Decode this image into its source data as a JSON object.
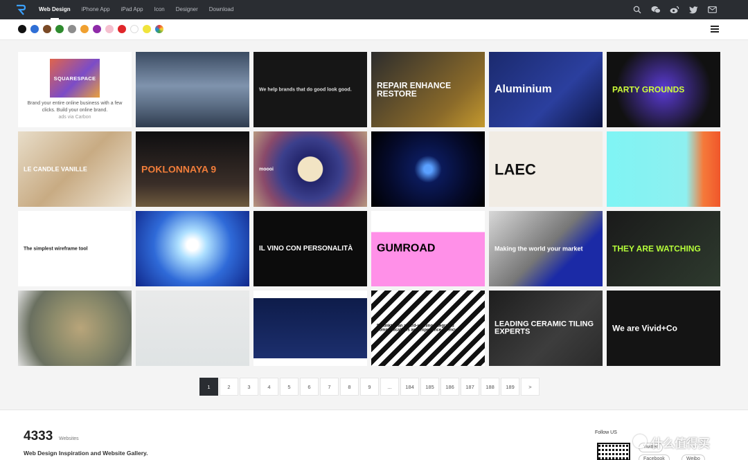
{
  "colors": {
    "topbar": "#2a2d32",
    "accent": "#1e90ff"
  },
  "nav": {
    "items": [
      {
        "label": "Web Design",
        "active": true
      },
      {
        "label": "iPhone App",
        "active": false
      },
      {
        "label": "iPad App",
        "active": false
      },
      {
        "label": "Icon",
        "active": false
      },
      {
        "label": "Designer",
        "active": false
      },
      {
        "label": "Download",
        "active": false
      }
    ],
    "icons": [
      "search-icon",
      "wechat-icon",
      "weibo-icon",
      "twitter-icon",
      "mail-icon"
    ]
  },
  "color_filter": {
    "swatches": [
      "#111111",
      "#2f6fd6",
      "#7a4a26",
      "#2e8b2e",
      "#8d8d8d",
      "#f0a030",
      "#8e2aa8",
      "#f5c0cf",
      "#e0262a",
      "#ffffff",
      "#f0e43c",
      "multicolor"
    ]
  },
  "gallery": {
    "ad": {
      "logo_text": "SQUARESPACE",
      "text": "Brand your entire online business with a few clicks. Build your online brand.",
      "via": "ads via Carbon"
    },
    "cards": [
      {
        "name": "polestar",
        "text": "",
        "bg": "linear-gradient(180deg,#3b4b62 0%,#7f93ad 45%,#5d6f86 70%,#2f3c4f 100%)",
        "fg": "#ffffff",
        "size": 8
      },
      {
        "name": "we-help-brands",
        "text": "We help brands that do good look good.",
        "bg": "#161616",
        "fg": "#dddddd",
        "size": 7
      },
      {
        "name": "repair-enhance-restore",
        "text": "REPAIR ENHANCE RESTORE",
        "bg": "linear-gradient(135deg,#2d2d2d,#8a6a2a 70%,#c59a2e)",
        "fg": "#ffffff",
        "size": 12
      },
      {
        "name": "aluminium",
        "text": "Aluminium",
        "bg": "linear-gradient(135deg,#1b2a6e,#2b3f9e 60%,#0c1440)",
        "fg": "#ffffff",
        "size": 16
      },
      {
        "name": "party-grounds",
        "text": "PARTY GROUNDS",
        "bg": "radial-gradient(circle at 50% 50%,#5b3bd6,#111 70%)",
        "fg": "#cfff3a",
        "size": 12
      },
      {
        "name": "le-candle-vanille",
        "text": "LE CANDLE VANILLE",
        "bg": "linear-gradient(135deg,#e8ddc9,#c8ab83 50%,#efe6d6)",
        "fg": "#ffffff",
        "size": 9
      },
      {
        "name": "poklonnaya",
        "text": "POKLONNAYA 9",
        "bg": "linear-gradient(180deg,#0e0e10,#3a2e28 70%,#6e5a3e)",
        "fg": "#f07d3a",
        "size": 14
      },
      {
        "name": "moooi",
        "text": "moooi",
        "bg": "radial-gradient(circle,#f2e4c4 18%,#23256b 19%,#3b3f8c 45%,#8a4a6a 70%,#b89a80)",
        "fg": "#ffffff",
        "size": 7
      },
      {
        "name": "particle-space",
        "text": "",
        "bg": "radial-gradient(circle,#5aa0ff 6%,#0b1a5a 20%,#050a2a 60%,#000)",
        "fg": "#ffffff",
        "size": 7
      },
      {
        "name": "laec",
        "text": "LAEC",
        "bg": "#f1ece4",
        "fg": "#111111",
        "size": 22
      },
      {
        "name": "cyan-orange",
        "text": "",
        "bg": "linear-gradient(90deg,#7ff4f4 0%,#8ef0f0 70%,#f57a3a 85%,#f0562a)",
        "fg": "#333333",
        "size": 7
      },
      {
        "name": "simplest-wireframe",
        "text": "The simplest wireframe tool",
        "bg": "#ffffff",
        "fg": "#222222",
        "size": 7
      },
      {
        "name": "solar-flare",
        "text": "",
        "bg": "radial-gradient(circle at 50% 45%,#ffffff 8%,#aee0ff 20%,#2f6ad8 55%,#10278a)",
        "fg": "#ffffff",
        "size": 7
      },
      {
        "name": "il-vino",
        "text": "IL VINO CON PERSONALITÀ",
        "bg": "#0c0c0c",
        "fg": "#ffffff",
        "size": 10
      },
      {
        "name": "gumroad",
        "text": "GUMROAD",
        "bg": "linear-gradient(180deg,#ffffff 0,#ffffff 28%,#ff90e8 28%,#ff90e8 100%)",
        "fg": "#000000",
        "size": 16
      },
      {
        "name": "making-world",
        "text": "Making the world your market",
        "bg": "linear-gradient(135deg,#d8d8d8,#777 50%,#1b2aa6 70%,#1b2aa6)",
        "fg": "#ffffff",
        "size": 9
      },
      {
        "name": "they-are-watching",
        "text": "THEY ARE WATCHING",
        "bg": "linear-gradient(135deg,#1a1a1a,#2e3a2e)",
        "fg": "#b6ff3a",
        "size": 12
      },
      {
        "name": "aerial-map",
        "text": "",
        "bg": "radial-gradient(circle at 55% 50%,#b9a57a,#8b8a6a 40%,#6a7060 70%,#e0e0e0)",
        "fg": "#333333",
        "size": 7
      },
      {
        "name": "chinese-calligraphy",
        "text": "",
        "bg": "linear-gradient(180deg,#e9eaea,#dfe3e4)",
        "fg": "#333333",
        "size": 7
      },
      {
        "name": "coral",
        "text": "",
        "bg": "linear-gradient(180deg,#ffffff 0,#ffffff 10%,#0e1c4a 10%,#1c2f6e 90%,#ffffff 90%)",
        "fg": "#e9c692",
        "size": 7
      },
      {
        "name": "distinkt",
        "text": "Distinkt is an award-winning integrated communications and experience agency",
        "bg": "repeating-linear-gradient(135deg,#111 0 7px,#fff 7px 14px)",
        "fg": "#111111",
        "size": 6
      },
      {
        "name": "leading-ceramic",
        "text": "LEADING CERAMIC TILING EXPERTS",
        "bg": "linear-gradient(135deg,#1e1e1e,#3d3d3d 60%,#2a2a2a)",
        "fg": "#ffffff",
        "size": 11
      },
      {
        "name": "vivid-co",
        "text": "We are Vivid+Co",
        "bg": "#141414",
        "fg": "#ffffff",
        "size": 12
      }
    ]
  },
  "pagination": {
    "pages": [
      "1",
      "2",
      "3",
      "4",
      "5",
      "6",
      "7",
      "8",
      "9",
      "...",
      "184",
      "185",
      "186",
      "187",
      "188",
      "189",
      ">"
    ],
    "current": "1"
  },
  "footer": {
    "count": "4333",
    "count_label": "Websites",
    "tagline": "Web Design Inspiration and Website Gallery.",
    "follow": "Follow US",
    "links": [
      "Twitter",
      "Facebook",
      "Weibo"
    ]
  },
  "watermark": "什么值得买"
}
